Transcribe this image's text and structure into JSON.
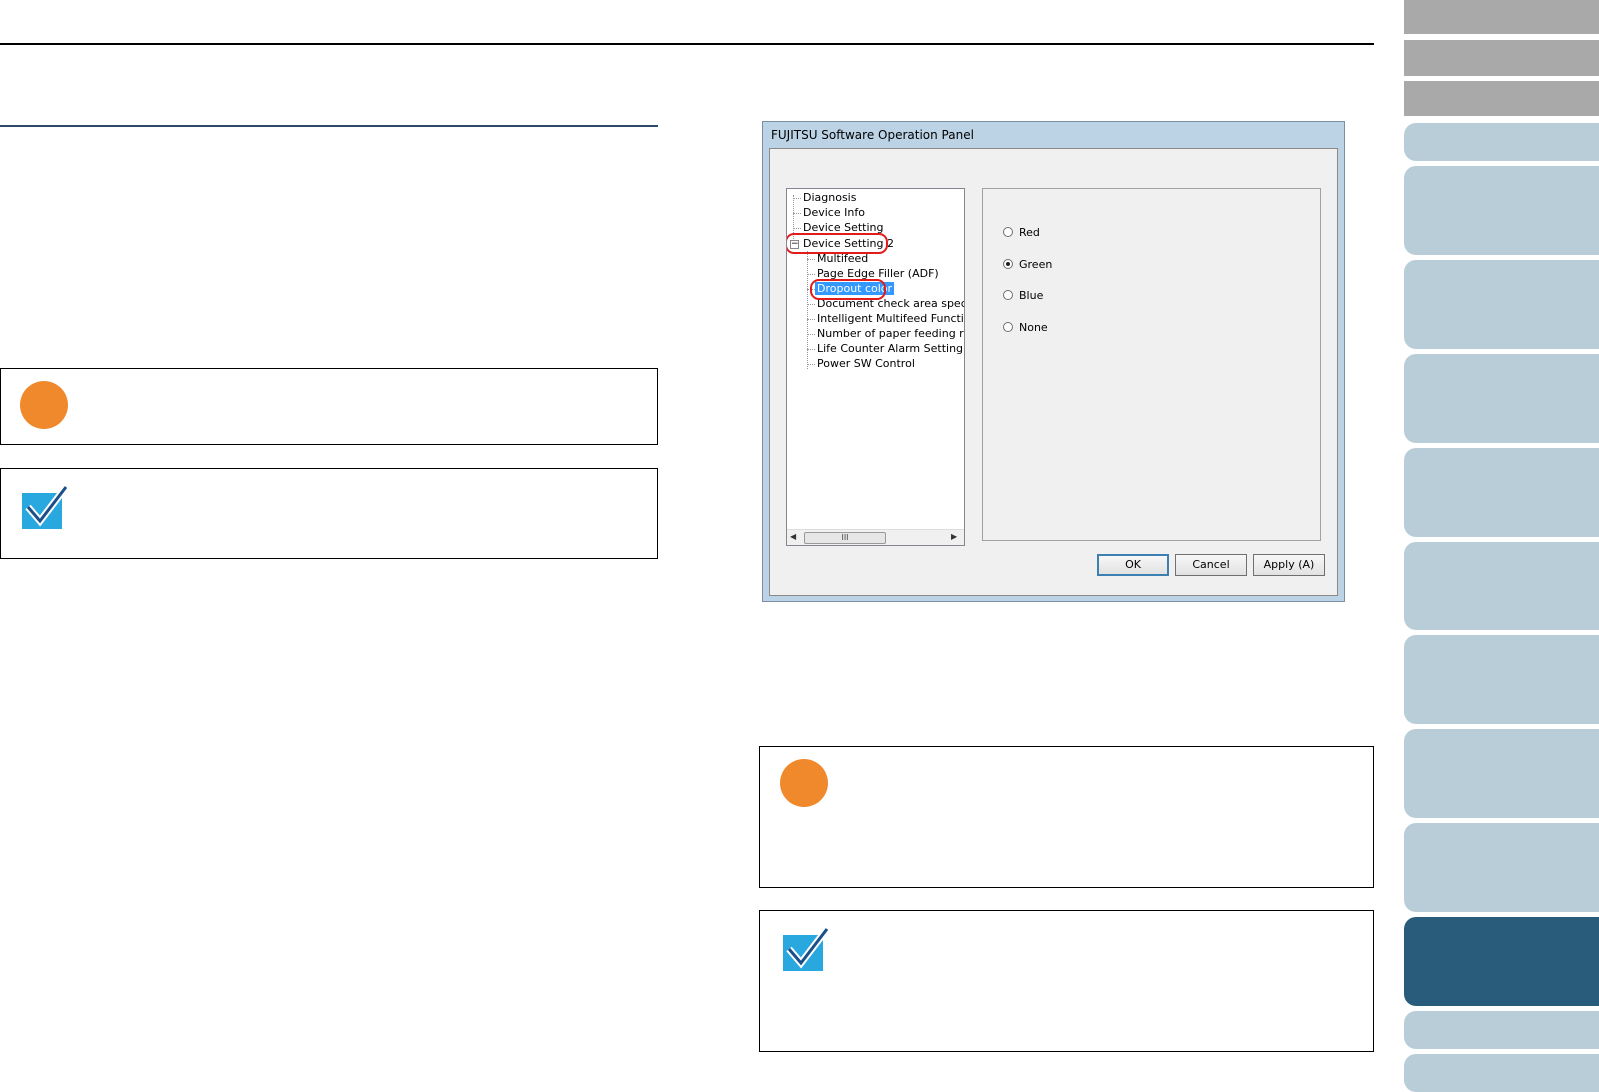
{
  "dialog": {
    "title": "FUJITSU Software Operation Panel",
    "tree": {
      "items": [
        {
          "label": "Diagnosis"
        },
        {
          "label": "Device Info"
        },
        {
          "label": "Device Setting"
        },
        {
          "label": "Device Setting 2",
          "expanded": true,
          "highlighted": true
        },
        {
          "label": "Multifeed"
        },
        {
          "label": "Page Edge Filler (ADF)"
        },
        {
          "label": "Dropout color",
          "selected": true,
          "highlighted": true
        },
        {
          "label": "Document check area specifica"
        },
        {
          "label": "Intelligent Multifeed Function"
        },
        {
          "label": "Number of paper feeding retries"
        },
        {
          "label": "Life Counter Alarm Setting"
        },
        {
          "label": "Power SW Control"
        }
      ],
      "expander": "−",
      "scroll_thumb": "III",
      "scroll_left": "◀",
      "scroll_right": "▶"
    },
    "options": [
      {
        "label": "Red",
        "checked": false
      },
      {
        "label": "Green",
        "checked": true
      },
      {
        "label": "Blue",
        "checked": false
      },
      {
        "label": "None",
        "checked": false
      }
    ],
    "buttons": {
      "ok": "OK",
      "cancel": "Cancel",
      "apply": "Apply (A)"
    }
  },
  "colors": {
    "important": "#f0892b",
    "hint": "#29a8e0",
    "active_tab": "#285c7a",
    "inactive_tab": "#b9cdd8",
    "gray_tab": "#a9a9a9",
    "highlight_ring": "#e21b1b",
    "selection": "#3399ff"
  },
  "icons": {
    "important": "important-circle-icon",
    "hint": "checkmark-hint-icon"
  }
}
